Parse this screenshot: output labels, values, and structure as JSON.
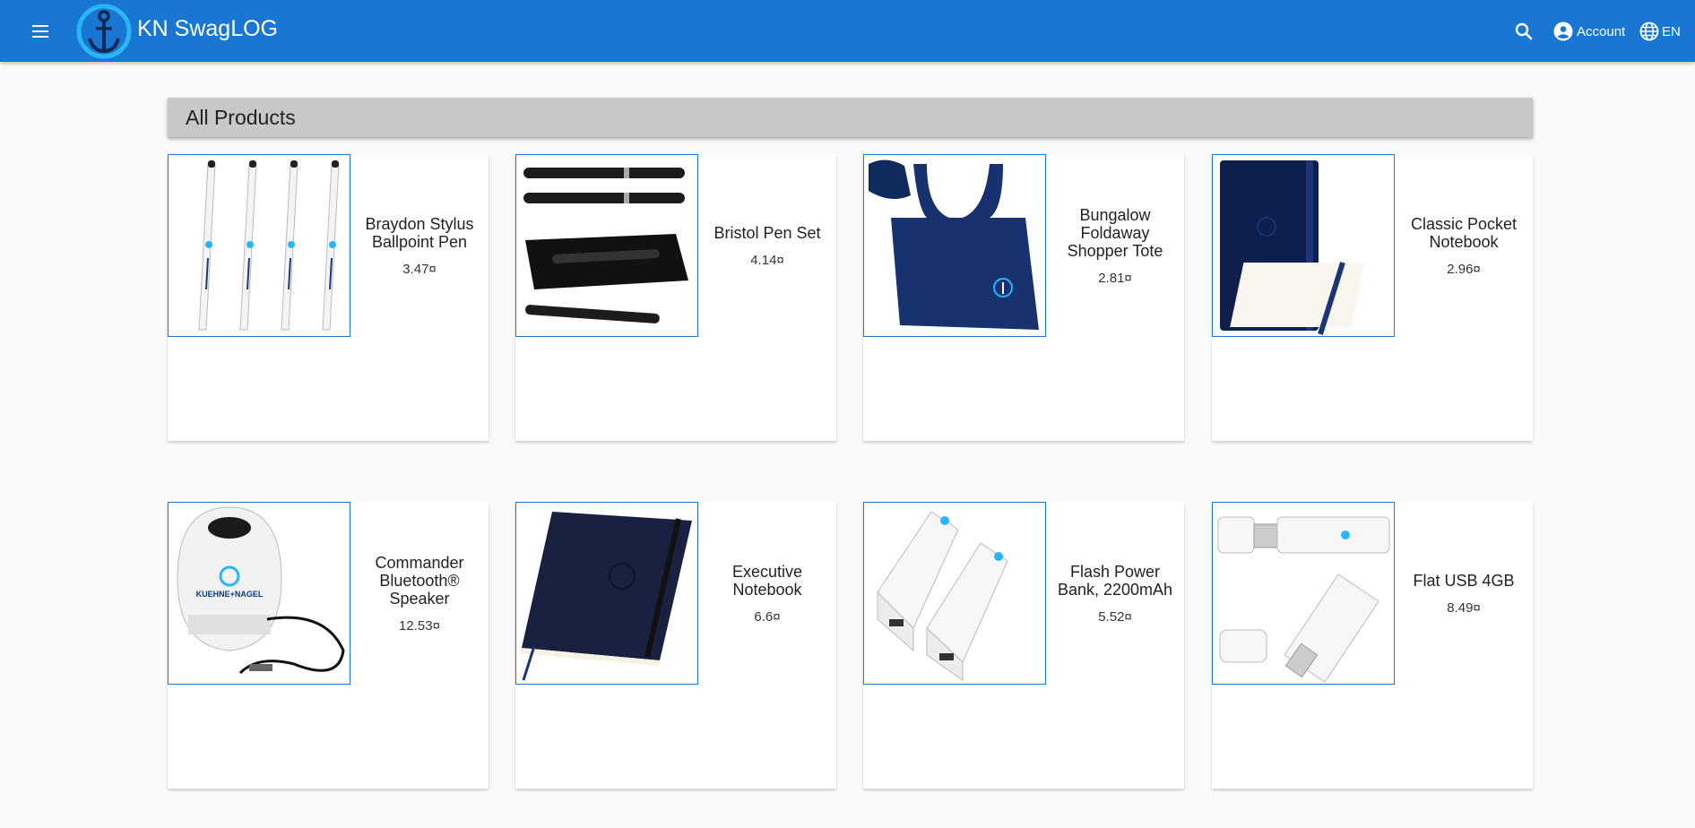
{
  "header": {
    "brand": "KN SwagLOG",
    "account_label": "Account",
    "language_label": "EN",
    "icons": [
      "menu-icon",
      "anchor-logo",
      "search-icon",
      "account-circle-icon",
      "globe-icon"
    ],
    "colors": {
      "appbar": "#1976d2",
      "accent": "#29b6f6"
    }
  },
  "section": {
    "title": "All Products"
  },
  "products": [
    {
      "name": "Braydon Stylus Ballpoint Pen",
      "price": "3.47¤"
    },
    {
      "name": "Bristol Pen Set",
      "price": "4.14¤"
    },
    {
      "name": "Bungalow Foldaway Shopper Tote",
      "price": "2.81¤"
    },
    {
      "name": "Classic Pocket Notebook",
      "price": "2.96¤"
    },
    {
      "name": "Commander Bluetooth® Speaker",
      "price": "12.53¤"
    },
    {
      "name": "Executive Notebook",
      "price": "6.6¤"
    },
    {
      "name": "Flash Power Bank, 2200mAh",
      "price": "5.52¤"
    },
    {
      "name": "Flat USB 4GB",
      "price": "8.49¤"
    }
  ]
}
